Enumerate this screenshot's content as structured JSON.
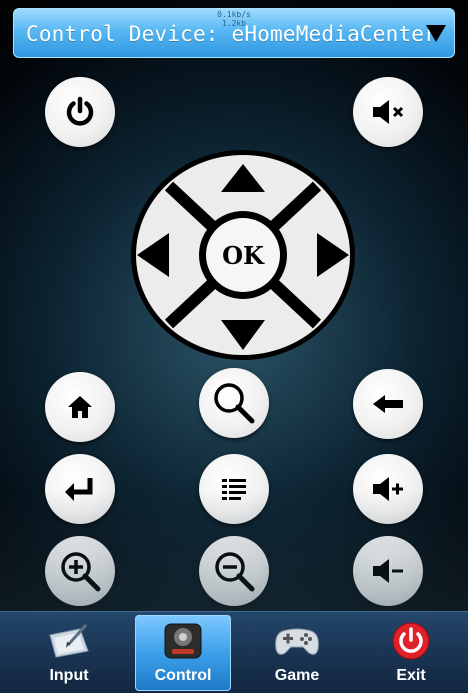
{
  "header": {
    "status_rate": "0.1kb/s",
    "status_rate2": "1.2kb",
    "title": "Control Device: eHomeMediaCenter"
  },
  "dpad": {
    "ok_label": "OK"
  },
  "tabs": [
    {
      "label": "Input",
      "icon": "input-icon"
    },
    {
      "label": "Control",
      "icon": "control-icon",
      "active": true
    },
    {
      "label": "Game",
      "icon": "gamepad-icon"
    },
    {
      "label": "Exit",
      "icon": "exit-icon"
    }
  ],
  "colors": {
    "header": "#56b7f2",
    "tabbar": "#1a3553",
    "active_tab": "#3da0ea",
    "exit_red": "#e0202a"
  }
}
